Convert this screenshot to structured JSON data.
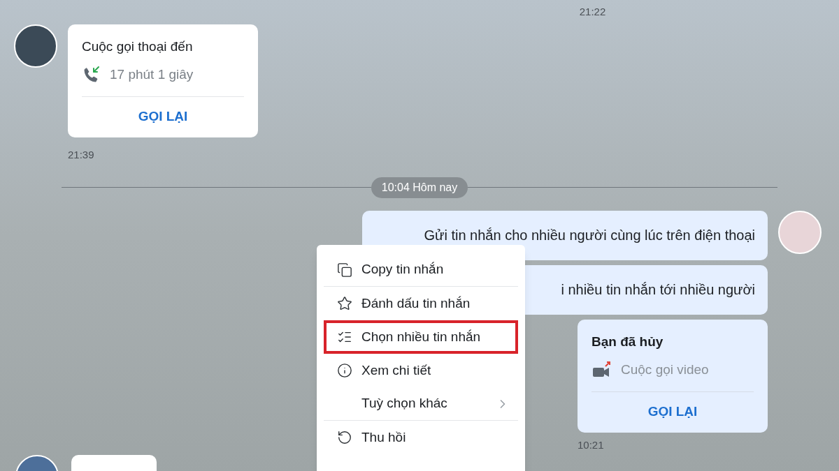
{
  "top_time": "21:22",
  "incoming_call": {
    "title": "Cuộc gọi thoại đến",
    "duration": "17 phút 1 giây",
    "action": "GỌI LẠI",
    "time": "21:39"
  },
  "date_separator": "10:04 Hôm nay",
  "messages": [
    {
      "text": "Gửi tin nhắn cho nhiều người cùng lúc trên điện thoại"
    },
    {
      "text": "i nhiều tin nhắn tới nhiều người"
    }
  ],
  "outgoing_call": {
    "title": "Bạn đã hủy",
    "subtitle": "Cuộc gọi video",
    "action": "GỌI LẠI",
    "time": "10:21"
  },
  "context_menu": [
    {
      "kind": "copy",
      "label": "Copy tin nhắn",
      "highlighted": false,
      "submenu": false,
      "divider_after": true
    },
    {
      "kind": "star",
      "label": "Đánh dấu tin nhắn",
      "highlighted": false,
      "submenu": false,
      "divider_after": false
    },
    {
      "kind": "select",
      "label": "Chọn nhiều tin nhắn",
      "highlighted": true,
      "submenu": false,
      "divider_after": false
    },
    {
      "kind": "info",
      "label": "Xem chi tiết",
      "highlighted": false,
      "submenu": false,
      "divider_after": false
    },
    {
      "kind": "more",
      "label": "Tuỳ chọn khác",
      "highlighted": false,
      "submenu": true,
      "divider_after": true
    },
    {
      "kind": "recall",
      "label": "Thu hồi",
      "highlighted": false,
      "submenu": false,
      "divider_after": false
    }
  ]
}
